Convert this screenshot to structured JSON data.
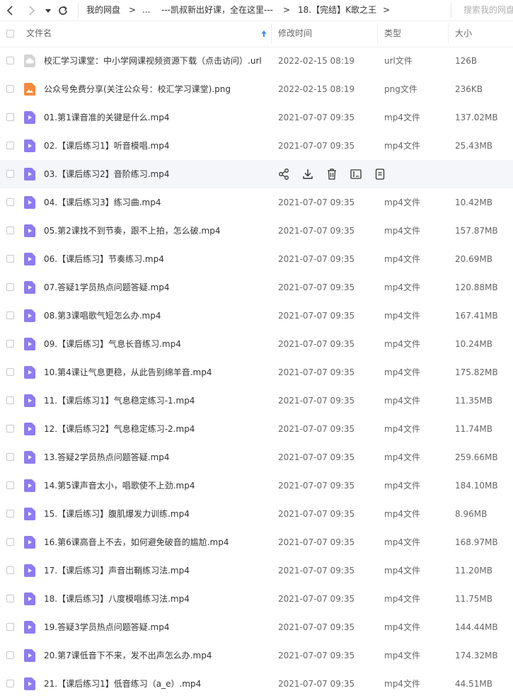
{
  "toolbar": {
    "back_icon": "chevron-left-icon",
    "forward_icon": "chevron-right-icon",
    "history_icon": "caret-down-icon",
    "refresh_icon": "refresh-icon",
    "breadcrumb": [
      "我的网盘",
      "...",
      "---凯叔新出好课，全在这里---",
      "18.【完结】K歌之王"
    ],
    "separator": ">",
    "search_placeholder": "搜索我的网盘"
  },
  "header": {
    "name": "文件名",
    "modified": "修改时间",
    "type": "类型",
    "size": "大小",
    "sort_icon": "sort-arrow-up-icon"
  },
  "colors": {
    "video_icon": "#8e7cf0",
    "image_icon": "#f58a3c",
    "link_icon": "#d0d0d0",
    "sort_arrow": "#3a8ee6",
    "hover_row": "#f5f6f9"
  },
  "files": [
    {
      "name": "校汇学习课堂：中小学网课视频资源下载（点击访问）.url",
      "date": "2022-02-15 08:19",
      "type": "url文件",
      "size": "126B",
      "icon": "link-file-icon"
    },
    {
      "name": "公众号免费分享(关注公众号：校汇学习课堂).png",
      "date": "2022-02-15 08:19",
      "type": "png文件",
      "size": "236KB",
      "icon": "image-file-icon"
    },
    {
      "name": "01.第1课音准的关键是什么.mp4",
      "date": "2021-07-07 09:35",
      "type": "mp4文件",
      "size": "137.02MB",
      "icon": "video-file-icon"
    },
    {
      "name": "02.【课后练习1】听音模唱.mp4",
      "date": "2021-07-07 09:35",
      "type": "mp4文件",
      "size": "25.43MB",
      "icon": "video-file-icon"
    },
    {
      "name": "03.【课后练习2】音阶练习.mp4",
      "date": "",
      "type": "",
      "size": "",
      "icon": "video-file-icon",
      "hover": true
    },
    {
      "name": "04.【课后练习3】练习曲.mp4",
      "date": "2021-07-07 09:35",
      "type": "mp4文件",
      "size": "10.42MB",
      "icon": "video-file-icon"
    },
    {
      "name": "05.第2课找不到节奏，跟不上拍，怎么破.mp4",
      "date": "2021-07-07 09:35",
      "type": "mp4文件",
      "size": "157.87MB",
      "icon": "video-file-icon"
    },
    {
      "name": "06.【课后练习】节奏练习.mp4",
      "date": "2021-07-07 09:35",
      "type": "mp4文件",
      "size": "20.69MB",
      "icon": "video-file-icon"
    },
    {
      "name": "07.答疑1学员热点问题答疑.mp4",
      "date": "2021-07-07 09:35",
      "type": "mp4文件",
      "size": "120.88MB",
      "icon": "video-file-icon"
    },
    {
      "name": "08.第3课唱歌气短怎么办.mp4",
      "date": "2021-07-07 09:35",
      "type": "mp4文件",
      "size": "167.41MB",
      "icon": "video-file-icon"
    },
    {
      "name": "09.【课后练习】气息长音练习.mp4",
      "date": "2021-07-07 09:35",
      "type": "mp4文件",
      "size": "10.24MB",
      "icon": "video-file-icon"
    },
    {
      "name": "10.第4课让气息更稳，从此告别绵羊音.mp4",
      "date": "2021-07-07 09:35",
      "type": "mp4文件",
      "size": "175.82MB",
      "icon": "video-file-icon"
    },
    {
      "name": "11.【课后练习1】气息稳定练习-1.mp4",
      "date": "2021-07-07 09:35",
      "type": "mp4文件",
      "size": "11.35MB",
      "icon": "video-file-icon"
    },
    {
      "name": "12.【课后练习2】气息稳定练习-2.mp4",
      "date": "2021-07-07 09:35",
      "type": "mp4文件",
      "size": "11.74MB",
      "icon": "video-file-icon"
    },
    {
      "name": "13.答疑2学员热点问题答疑.mp4",
      "date": "2021-07-07 09:35",
      "type": "mp4文件",
      "size": "259.66MB",
      "icon": "video-file-icon"
    },
    {
      "name": "14.第5课声音太小，唱歌使不上劲.mp4",
      "date": "2021-07-07 09:35",
      "type": "mp4文件",
      "size": "184.10MB",
      "icon": "video-file-icon"
    },
    {
      "name": "15.【课后练习】腹肌爆发力训练.mp4",
      "date": "2021-07-07 09:35",
      "type": "mp4文件",
      "size": "8.96MB",
      "icon": "video-file-icon"
    },
    {
      "name": "16.第6课高音上不去，如何避免破音的尴尬.mp4",
      "date": "2021-07-07 09:35",
      "type": "mp4文件",
      "size": "168.97MB",
      "icon": "video-file-icon"
    },
    {
      "name": "17.【课后练习】声音出鞘练习法.mp4",
      "date": "2021-07-07 09:35",
      "type": "mp4文件",
      "size": "11.20MB",
      "icon": "video-file-icon"
    },
    {
      "name": "18.【课后练习】八度模唱练习法.mp4",
      "date": "2021-07-07 09:35",
      "type": "mp4文件",
      "size": "11.75MB",
      "icon": "video-file-icon"
    },
    {
      "name": "19.答疑3学员热点问题答疑.mp4",
      "date": "2021-07-07 09:35",
      "type": "mp4文件",
      "size": "144.44MB",
      "icon": "video-file-icon"
    },
    {
      "name": "20.第7课低音下不来，发不出声怎么办.mp4",
      "date": "2021-07-07 09:35",
      "type": "mp4文件",
      "size": "174.32MB",
      "icon": "video-file-icon"
    },
    {
      "name": "21.【课后练习1】低音练习（a_e）.mp4",
      "date": "2021-07-07 09:35",
      "type": "mp4文件",
      "size": "44.51MB",
      "icon": "video-file-icon"
    }
  ],
  "row_actions": [
    "share-icon",
    "download-icon",
    "delete-icon",
    "rename-icon",
    "more-icon"
  ]
}
